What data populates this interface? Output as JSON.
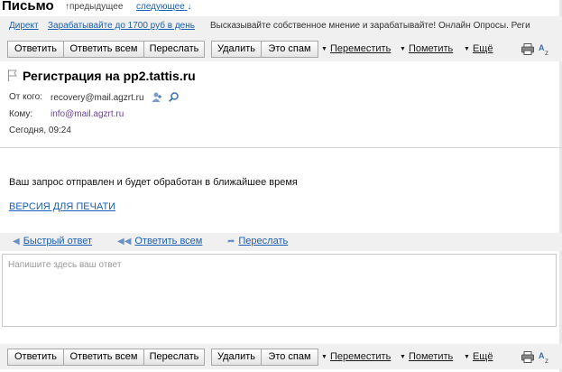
{
  "header": {
    "title": "Письмо",
    "prev_label": "предыдущее",
    "next_label": "следующее"
  },
  "ad": {
    "label": "Директ",
    "link": "Зарабатывайте до 1700 руб в день",
    "text": "Высказывайте собственное мнение и зарабатывайте! Онлайн Опросы. Реги"
  },
  "toolbar": {
    "reply": "Ответить",
    "reply_all": "Ответить всем",
    "forward": "Переслать",
    "delete": "Удалить",
    "spam": "Это спам",
    "move": "Переместить",
    "mark": "Пометить",
    "more": "Ещё"
  },
  "message": {
    "subject": "Регистрация на pp2.tattis.ru",
    "from_label": "От кого:",
    "from": "recovery@mail.agzrt.ru",
    "to_label": "Кому:",
    "to": "info@mail.agzrt.ru",
    "date": "Сегодня, 09:24",
    "body": "Ваш запрос отправлен и будет обработан в ближайшее время",
    "print_link": "ВЕРСИЯ ДЛЯ ПЕЧАТИ"
  },
  "quick_reply": {
    "quick": "Быстрый ответ",
    "reply_all": "Ответить всем",
    "forward": "Переслать",
    "placeholder": "Напишите здесь ваш ответ"
  },
  "icons": [
    "flag-icon",
    "add-contact-icon",
    "search-icon",
    "print-icon",
    "translate-icon",
    "reply-icon",
    "reply-all-icon",
    "forward-icon"
  ]
}
